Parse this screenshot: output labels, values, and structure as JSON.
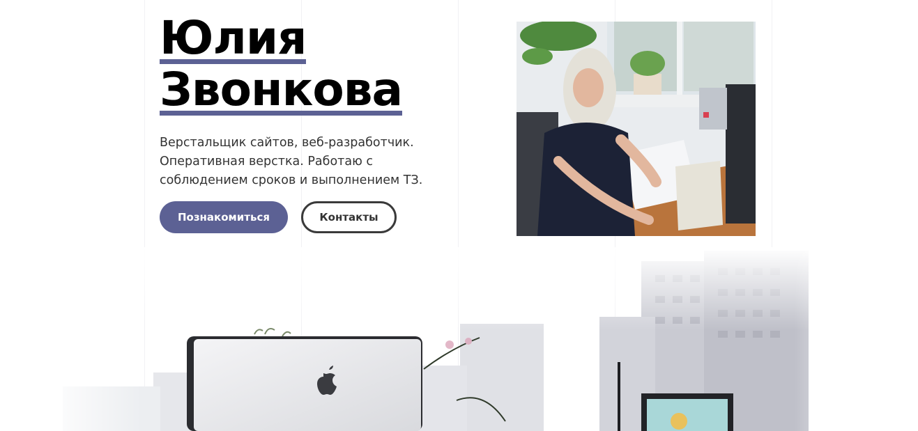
{
  "hero": {
    "first_name": "Юлия",
    "last_name": "Звонкова",
    "description": "Верстальщик сайтов, веб-разработчик. Оперативная верстка. Работаю с соблюдением сроков и выполнением ТЗ."
  },
  "buttons": {
    "primary_label": "Познакомиться",
    "secondary_label": "Контакты"
  },
  "colors": {
    "accent": "#5c6194",
    "outline": "#3a3a3a"
  },
  "icons": {
    "apple_logo": "apple-logo-icon"
  }
}
